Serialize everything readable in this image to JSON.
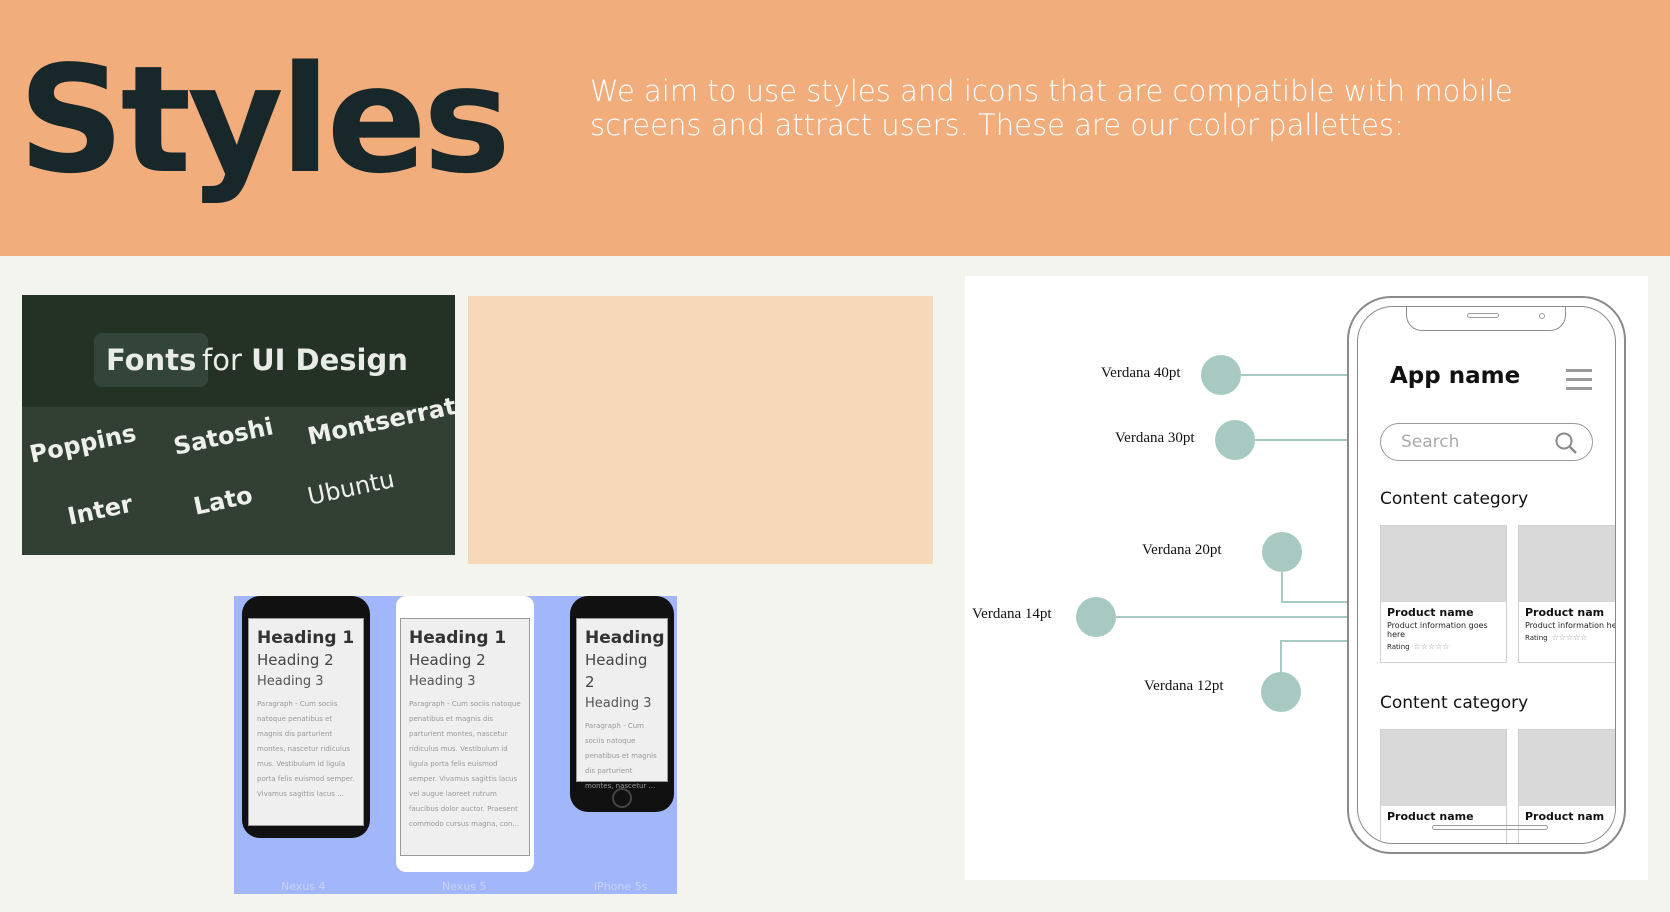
{
  "header": {
    "title": "Styles",
    "description": "We aim to use styles and icons that are compatible with mobile screens and attract users. These are our color pallettes:"
  },
  "fonts_card": {
    "pill_label": "Fonts",
    "for_text": "for",
    "ui_design": "UI Design",
    "font_names": [
      "Poppins",
      "Satoshi",
      "Montserrat",
      "Inter",
      "Lato",
      "Ubuntu"
    ]
  },
  "devices": {
    "screens": [
      {
        "h1": "Heading 1",
        "h2": "Heading 2",
        "h3": "Heading 3",
        "paragraph": "Paragraph - Cum sociis natoque penatibus et magnis dis parturient montes, nascetur ridiculus mus. Vestibulum id ligula porta felis euismod semper. Vivamus sagittis lacus ..."
      },
      {
        "h1": "Heading 1",
        "h2": "Heading 2",
        "h3": "Heading 3",
        "paragraph": "Paragraph - Cum sociis natoque penatibus et magnis dis parturient montes, nascetur ridiculus mus. Vestibulum id ligula porta felis euismod semper. Vivamus sagittis lacus vel augue laoreet rutrum faucibus dolor auctor. Praesent commodo cursus magna, con..."
      },
      {
        "h1": "Heading",
        "h2": "Heading 2",
        "h3": "Heading 3",
        "paragraph": "Paragraph - Cum sociis natoque penatibus et magnis dis parturient montes, nascetur ..."
      }
    ],
    "labels": [
      "Nexus 4",
      "Nexus 5",
      "iPhone 5s"
    ]
  },
  "wireframe": {
    "labels": {
      "v40": "Verdana 40pt",
      "v30": "Verdana 30pt",
      "v20": "Verdana 20pt",
      "v14": "Verdana 14pt",
      "v12": "Verdana 12pt"
    },
    "app_name": "App name",
    "search_placeholder": "Search",
    "category_1": "Content category",
    "category_2": "Content category",
    "product_name": "Product name",
    "product_name_cut": "Product nam",
    "product_info": "Product information goes here",
    "product_info_cut": "Product information here",
    "rating": "Rating",
    "stars": "☆☆☆☆☆"
  },
  "colors": {
    "header_bg": "#f2ad7c",
    "fonts_card_bg": "#323f33",
    "peach_swatch": "#f7d9b9",
    "device_bg": "#a2b7fb",
    "accent_teal": "#a7c9c1"
  }
}
